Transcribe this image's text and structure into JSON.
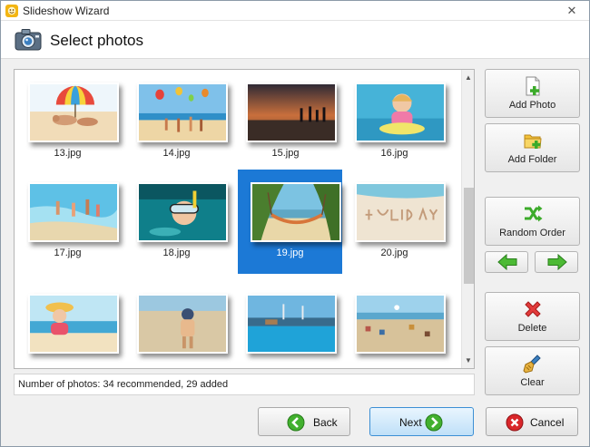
{
  "window": {
    "title": "Slideshow Wizard",
    "close_glyph": "✕"
  },
  "header": {
    "title": "Select photos",
    "icon": "camera-icon"
  },
  "gallery": {
    "photos": [
      {
        "caption": "13.jpg",
        "scene": "beach-umbrella"
      },
      {
        "caption": "14.jpg",
        "scene": "beach-balloons"
      },
      {
        "caption": "15.jpg",
        "scene": "sunset-people"
      },
      {
        "caption": "16.jpg",
        "scene": "girl-pool"
      },
      {
        "caption": "17.jpg",
        "scene": "kids-surf"
      },
      {
        "caption": "18.jpg",
        "scene": "snorkel"
      },
      {
        "caption": "19.jpg",
        "scene": "hammock",
        "selected": true
      },
      {
        "caption": "20.jpg",
        "scene": "holiday-sand"
      },
      {
        "caption": "",
        "scene": "girl-hat"
      },
      {
        "caption": "",
        "scene": "child-beach"
      },
      {
        "caption": "",
        "scene": "resort-pool"
      },
      {
        "caption": "",
        "scene": "beach-crowd"
      }
    ],
    "scroll_fraction": 0.55
  },
  "status": {
    "text": "Number of photos: 34 recommended, 29 added"
  },
  "side": {
    "add_photo": "Add Photo",
    "add_folder": "Add Folder",
    "random_order": "Random Order",
    "delete": "Delete",
    "clear": "Clear"
  },
  "footer": {
    "back": "Back",
    "next": "Next",
    "cancel": "Cancel"
  },
  "colors": {
    "selection": "#1c79d6",
    "accent_green": "#3cab2a",
    "cancel_red": "#d9262a",
    "next_border": "#3c8fd4"
  }
}
